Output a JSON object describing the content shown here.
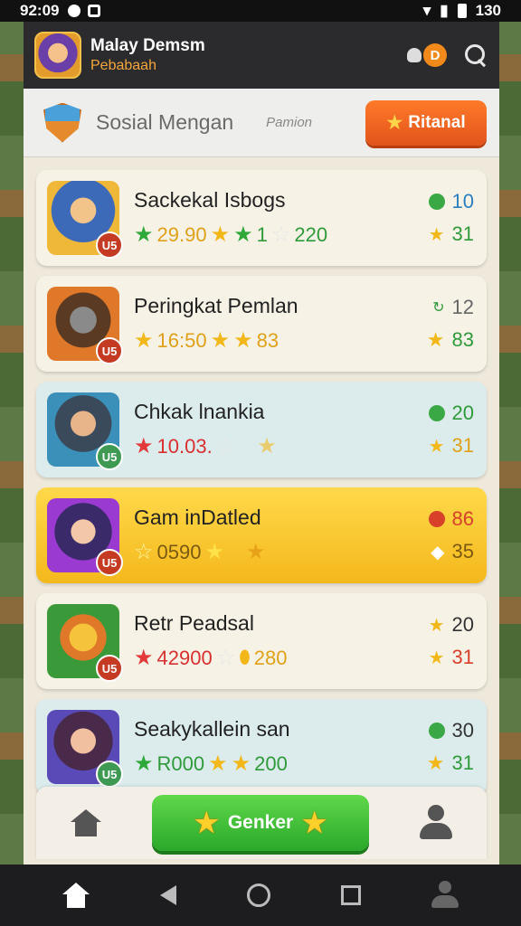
{
  "status_bar": {
    "time": "92:09",
    "battery": "130"
  },
  "app_header": {
    "title": "Malay Demsm",
    "subtitle": "Pebabaah",
    "badge_letter": "D"
  },
  "sub_header": {
    "title": "Sosial Mengan",
    "hint": "Pamion",
    "button_label": "Ritanal"
  },
  "cards": [
    {
      "title": "Sackekal Isbogs",
      "stats": [
        "29.90",
        "1",
        "220"
      ],
      "right_top": "10",
      "right_bottom": "31",
      "level": "U5",
      "theme": "cream"
    },
    {
      "title": "Peringkat Pemlan",
      "stats": [
        "16:50",
        "",
        "83"
      ],
      "right_top": "12",
      "right_bottom": "83",
      "level": "U5",
      "theme": "cream"
    },
    {
      "title": "Chkak lnankia",
      "stats": [
        "10.03.",
        "",
        ""
      ],
      "right_top": "20",
      "right_bottom": "31",
      "level": "U5",
      "theme": "blue"
    },
    {
      "title": "Gam inDatled",
      "stats": [
        "0590",
        "",
        ""
      ],
      "right_top": "86",
      "right_bottom": "35",
      "level": "U5",
      "theme": "yellow"
    },
    {
      "title": "Retr Peadsal",
      "stats": [
        "42900",
        "280",
        ""
      ],
      "right_top": "20",
      "right_bottom": "31",
      "level": "U5",
      "theme": "cream"
    },
    {
      "title": "Seakykallein san",
      "stats": [
        "R000",
        "200",
        ""
      ],
      "right_top": "30",
      "right_bottom": "31",
      "level": "U5",
      "theme": "blue"
    }
  ],
  "bottom_panel": {
    "cta_label": "Genker"
  },
  "colors": {
    "accent_orange": "#e2531a",
    "cta_green": "#2aa82a",
    "appbar": "#2b2b2d"
  }
}
